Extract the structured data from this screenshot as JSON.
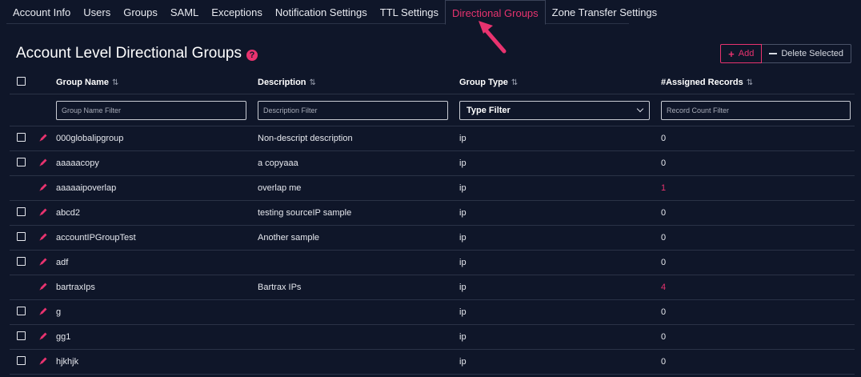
{
  "tabs": [
    {
      "label": "Account Info",
      "active": false
    },
    {
      "label": "Users",
      "active": false
    },
    {
      "label": "Groups",
      "active": false
    },
    {
      "label": "SAML",
      "active": false
    },
    {
      "label": "Exceptions",
      "active": false
    },
    {
      "label": "Notification Settings",
      "active": false
    },
    {
      "label": "TTL Settings",
      "active": false
    },
    {
      "label": "Directional Groups",
      "active": true
    },
    {
      "label": "Zone Transfer Settings",
      "active": false
    }
  ],
  "page": {
    "title": "Account Level Directional Groups",
    "help_icon": "help-circle-icon"
  },
  "actions": {
    "add_label": "Add",
    "delete_label": "Delete Selected"
  },
  "table": {
    "columns": {
      "name": "Group Name",
      "description": "Description",
      "type": "Group Type",
      "records": "#Assigned Records"
    },
    "sort_icon": "⇅",
    "filters": {
      "name_placeholder": "Group Name Filter",
      "description_placeholder": "Description Filter",
      "type_value": "Type Filter",
      "records_placeholder": "Record Count Filter"
    },
    "rows": [
      {
        "name": "000globalipgroup",
        "description": "Non-descript description",
        "type": "ip",
        "records": "0",
        "checkbox": true
      },
      {
        "name": "aaaaacopy",
        "description": "a copyaaa",
        "type": "ip",
        "records": "0",
        "checkbox": true
      },
      {
        "name": "aaaaaipoverlap",
        "description": "overlap me",
        "type": "ip",
        "records": "1",
        "checkbox": false
      },
      {
        "name": "abcd2",
        "description": "testing sourceIP sample",
        "type": "ip",
        "records": "0",
        "checkbox": true
      },
      {
        "name": "accountIPGroupTest",
        "description": "Another sample",
        "type": "ip",
        "records": "0",
        "checkbox": true
      },
      {
        "name": "adf",
        "description": "",
        "type": "ip",
        "records": "0",
        "checkbox": true
      },
      {
        "name": "bartraxIps",
        "description": "Bartrax IPs",
        "type": "ip",
        "records": "4",
        "checkbox": false
      },
      {
        "name": "g",
        "description": "",
        "type": "ip",
        "records": "0",
        "checkbox": true
      },
      {
        "name": "gg1",
        "description": "",
        "type": "ip",
        "records": "0",
        "checkbox": true
      },
      {
        "name": "hjkhjk",
        "description": "",
        "type": "ip",
        "records": "0",
        "checkbox": true
      }
    ]
  },
  "colors": {
    "background": "#0f1629",
    "accent": "#e8336f",
    "border": "#2a3246"
  }
}
